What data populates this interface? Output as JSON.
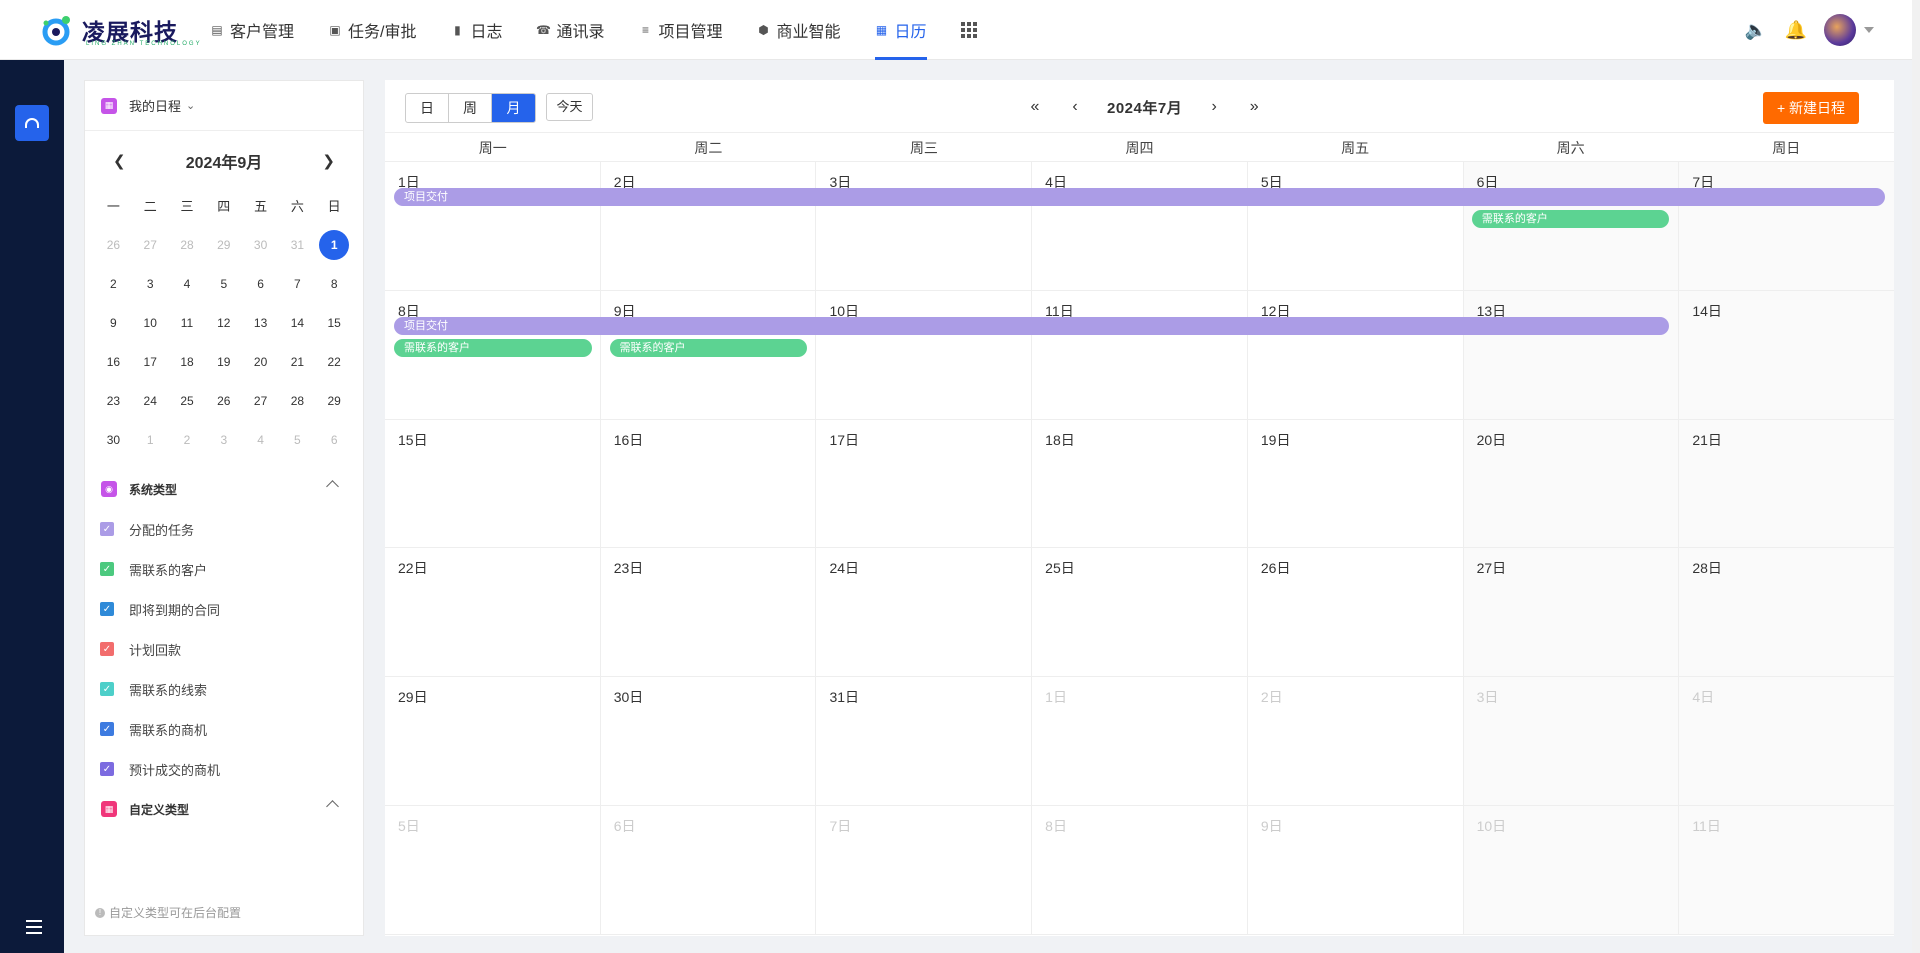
{
  "brand": {
    "name": "凌展科技",
    "tagline": "LING ZHAN TECHNOLOGY"
  },
  "nav": [
    {
      "label": "客户管理",
      "icon": "building-icon"
    },
    {
      "label": "任务/审批",
      "icon": "briefcase-icon"
    },
    {
      "label": "日志",
      "icon": "notebook-icon"
    },
    {
      "label": "通讯录",
      "icon": "phone-book-icon"
    },
    {
      "label": "项目管理",
      "icon": "list-icon"
    },
    {
      "label": "商业智能",
      "icon": "shield-icon"
    },
    {
      "label": "日历",
      "icon": "calendar-icon",
      "active": true
    }
  ],
  "sidebar": {
    "title": "我的日程",
    "mini": {
      "title": "2024年9月",
      "weekdays": [
        "一",
        "二",
        "三",
        "四",
        "五",
        "六",
        "日"
      ],
      "weeks": [
        [
          "26",
          "27",
          "28",
          "29",
          "30",
          "31",
          "1"
        ],
        [
          "2",
          "3",
          "4",
          "5",
          "6",
          "7",
          "8"
        ],
        [
          "9",
          "10",
          "11",
          "12",
          "13",
          "14",
          "15"
        ],
        [
          "16",
          "17",
          "18",
          "19",
          "20",
          "21",
          "22"
        ],
        [
          "23",
          "24",
          "25",
          "26",
          "27",
          "28",
          "29"
        ],
        [
          "30",
          "1",
          "2",
          "3",
          "4",
          "5",
          "6"
        ]
      ],
      "selected": "1"
    },
    "system_title": "系统类型",
    "system_items": [
      {
        "label": "分配的任务",
        "color": "#ab9ce6"
      },
      {
        "label": "需联系的客户",
        "color": "#4cc97f"
      },
      {
        "label": "即将到期的合同",
        "color": "#2f8ad8"
      },
      {
        "label": "计划回款",
        "color": "#f26d6d"
      },
      {
        "label": "需联系的线索",
        "color": "#4dcfc9"
      },
      {
        "label": "需联系的商机",
        "color": "#3d7be0"
      },
      {
        "label": "预计成交的商机",
        "color": "#7c6be0"
      }
    ],
    "custom_title": "自定义类型",
    "note": "自定义类型可在后台配置"
  },
  "toolbar": {
    "views": [
      "日",
      "周",
      "月"
    ],
    "active_view": "月",
    "today": "今天",
    "title": "2024年7月",
    "new_button": "+ 新建日程"
  },
  "calendar": {
    "weekdays": [
      "周一",
      "周二",
      "周三",
      "周四",
      "周五",
      "周六",
      "周日"
    ],
    "weeks": [
      [
        {
          "d": "1日"
        },
        {
          "d": "2日"
        },
        {
          "d": "3日"
        },
        {
          "d": "4日"
        },
        {
          "d": "5日"
        },
        {
          "d": "6日"
        },
        {
          "d": "7日"
        }
      ],
      [
        {
          "d": "8日"
        },
        {
          "d": "9日"
        },
        {
          "d": "10日"
        },
        {
          "d": "11日"
        },
        {
          "d": "12日"
        },
        {
          "d": "13日"
        },
        {
          "d": "14日"
        }
      ],
      [
        {
          "d": "15日"
        },
        {
          "d": "16日"
        },
        {
          "d": "17日"
        },
        {
          "d": "18日"
        },
        {
          "d": "19日"
        },
        {
          "d": "20日"
        },
        {
          "d": "21日"
        }
      ],
      [
        {
          "d": "22日"
        },
        {
          "d": "23日"
        },
        {
          "d": "24日"
        },
        {
          "d": "25日"
        },
        {
          "d": "26日"
        },
        {
          "d": "27日"
        },
        {
          "d": "28日"
        }
      ],
      [
        {
          "d": "29日"
        },
        {
          "d": "30日"
        },
        {
          "d": "31日"
        },
        {
          "d": "1日",
          "out": true
        },
        {
          "d": "2日",
          "out": true
        },
        {
          "d": "3日",
          "out": true
        },
        {
          "d": "4日",
          "out": true
        }
      ],
      [
        {
          "d": "5日",
          "out": true
        },
        {
          "d": "6日",
          "out": true
        },
        {
          "d": "7日",
          "out": true
        },
        {
          "d": "8日",
          "out": true
        },
        {
          "d": "9日",
          "out": true
        },
        {
          "d": "10日",
          "out": true
        },
        {
          "d": "11日",
          "out": true
        }
      ]
    ],
    "events": [
      {
        "week": 0,
        "start": 0,
        "span": 7,
        "row": 0,
        "title": "项目交付",
        "color": "purple"
      },
      {
        "week": 0,
        "start": 5,
        "span": 1,
        "row": 1,
        "title": "需联系的客户",
        "color": "green"
      },
      {
        "week": 1,
        "start": 0,
        "span": 6,
        "row": 0,
        "title": "项目交付",
        "color": "purple"
      },
      {
        "week": 1,
        "start": 0,
        "span": 1,
        "row": 1,
        "title": "需联系的客户",
        "color": "green"
      },
      {
        "week": 1,
        "start": 1,
        "span": 1,
        "row": 1,
        "title": "需联系的客户",
        "color": "green"
      }
    ]
  }
}
